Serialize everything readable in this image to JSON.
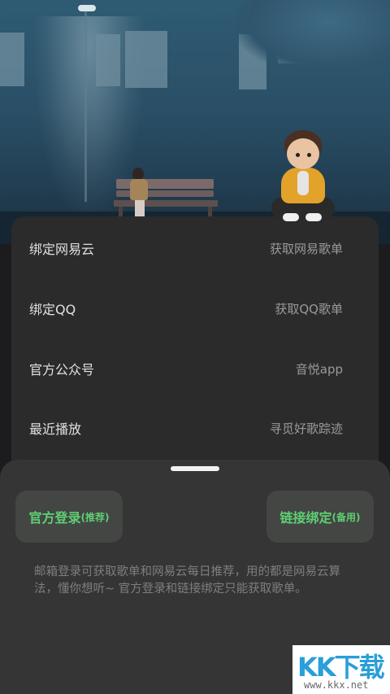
{
  "list": {
    "items": [
      {
        "label": "绑定网易云",
        "value": "获取网易歌单"
      },
      {
        "label": "绑定QQ",
        "value": "获取QQ歌单"
      },
      {
        "label": "官方公众号",
        "value": "音悦app"
      },
      {
        "label": "最近播放",
        "value": "寻觅好歌踪迹"
      }
    ]
  },
  "sheet": {
    "official_login": {
      "main": "官方登录",
      "sub": "(推荐)"
    },
    "link_bind": {
      "main": "链接绑定",
      "sub": "(备用)"
    },
    "note": "邮箱登录可获取歌单和网易云每日推荐，用的都是网易云算法，懂你想听~ 官方登录和链接绑定只能获取歌单。"
  },
  "watermark": {
    "logo": "KK下载",
    "site": "www.kkx.net"
  },
  "colors": {
    "accent_green": "#5fcf74",
    "panel_bg": "#2b2b2c",
    "sheet_bg": "#353535"
  }
}
